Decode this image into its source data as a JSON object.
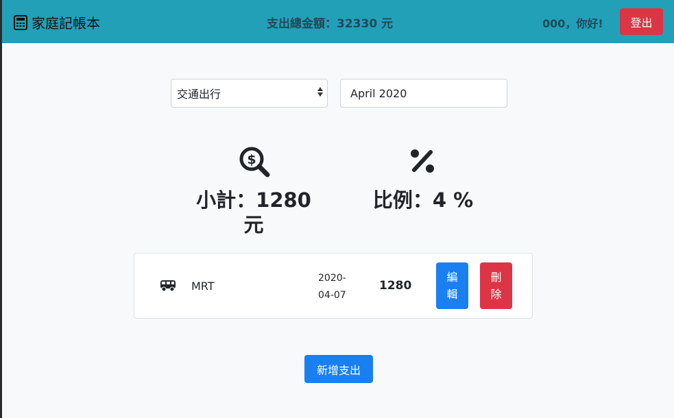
{
  "header": {
    "brand_label": "家庭記帳本",
    "brand_icon": "calculator-icon",
    "total_text": "支出總金額：32330 元",
    "greeting": "000，你好!",
    "logout_label": "登出"
  },
  "filters": {
    "category_value": "交通出行",
    "month_value": "April 2020"
  },
  "stats": {
    "subtotal_icon": "search-dollar-icon",
    "subtotal_text": "小計：1280 元",
    "ratio_icon": "percent-icon",
    "ratio_text": "比例：4 %"
  },
  "expenses": [
    {
      "icon": "bus-icon",
      "name": "MRT",
      "date": "2020-04-07",
      "amount": "1280",
      "edit_label": "編輯",
      "delete_label": "刪除"
    }
  ],
  "actions": {
    "add_label": "新增支出"
  },
  "colors": {
    "navbar": "#22a0b8",
    "danger": "#dc3545",
    "primary": "#1a7ff0",
    "background": "#f8f9fa"
  }
}
